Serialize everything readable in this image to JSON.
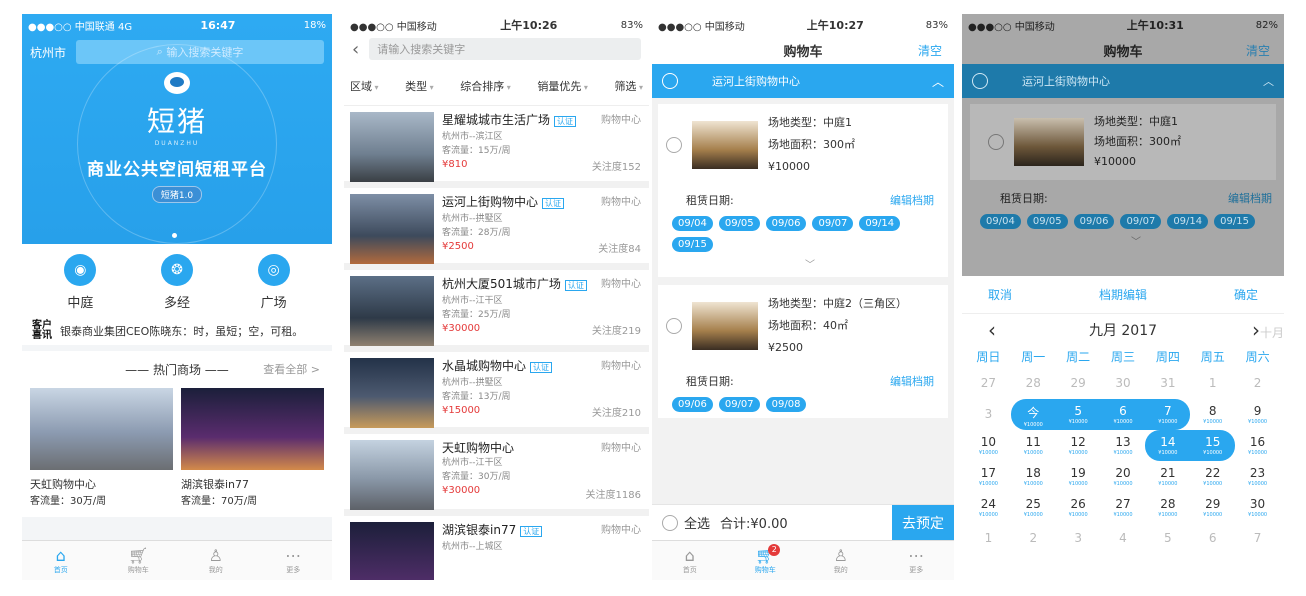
{
  "phone1": {
    "status": {
      "carrier": "●●●○○ 中国联通 4G",
      "time": "16:47",
      "battery": "18%"
    },
    "city": "杭州市",
    "search_placeholder": "输入搜索关键字",
    "brand": "短猪",
    "brand_sub": "DUANZHU",
    "slogan": "商业公共空间短租平台",
    "version": "短猪1.0",
    "categories": [
      "中庭",
      "多经",
      "广场"
    ],
    "news_tag": "客户 喜讯",
    "news": "银泰商业集团CEO陈晓东：时，虽短；空，可租。",
    "hot_title": "—— 热门商场 ——",
    "hot_all": "查看全部 >",
    "malls": [
      {
        "name": "天虹购物中心",
        "flow": "客流量：30万/周"
      },
      {
        "name": "湖滨银泰in77",
        "flow": "客流量：70万/周"
      }
    ],
    "tabs": [
      "首页",
      "购物车",
      "我的",
      "更多"
    ]
  },
  "phone2": {
    "status": {
      "carrier": "●●●○○ 中国移动",
      "time": "上午10:26",
      "battery": "83%"
    },
    "search_placeholder": "请输入搜索关键字",
    "filters": [
      "区域",
      "类型",
      "综合排序",
      "销量优先",
      "筛选"
    ],
    "items": [
      {
        "title": "星耀城城市生活广场",
        "cert": "认证",
        "type": "购物中心",
        "district": "杭州市--滨江区",
        "flow": "客流量：15万/周",
        "price": "¥810",
        "follow": "关注度152"
      },
      {
        "title": "运河上街购物中心",
        "cert": "认证",
        "type": "购物中心",
        "district": "杭州市--拱墅区",
        "flow": "客流量：28万/周",
        "price": "¥2500",
        "follow": "关注度84"
      },
      {
        "title": "杭州大厦501城市广场",
        "cert": "认证",
        "type": "购物中心",
        "district": "杭州市--江干区",
        "flow": "客流量：25万/周",
        "price": "¥30000",
        "follow": "关注度219"
      },
      {
        "title": "水晶城购物中心",
        "cert": "认证",
        "type": "购物中心",
        "district": "杭州市--拱墅区",
        "flow": "客流量：13万/周",
        "price": "¥15000",
        "follow": "关注度210"
      },
      {
        "title": "天虹购物中心",
        "cert": "",
        "type": "购物中心",
        "district": "杭州市--江干区",
        "flow": "客流量：30万/周",
        "price": "¥30000",
        "follow": "关注度1186"
      },
      {
        "title": "湖滨银泰in77",
        "cert": "认证",
        "type": "购物中心",
        "district": "杭州市--上城区",
        "flow": "",
        "price": "",
        "follow": ""
      }
    ]
  },
  "phone3": {
    "status": {
      "carrier": "●●●○○ 中国移动",
      "time": "上午10:27",
      "battery": "83%"
    },
    "title": "购物车",
    "clear": "清空",
    "group": "运河上街购物中心",
    "venues": [
      {
        "type": "场地类型：中庭1",
        "area": "场地面积：300㎡",
        "price": "¥10000",
        "rent_label": "租赁日期:",
        "edit": "编辑档期",
        "dates": [
          "09/04",
          "09/05",
          "09/06",
          "09/07",
          "09/14",
          "09/15"
        ]
      },
      {
        "type": "场地类型：中庭2（三角区）",
        "area": "场地面积：40㎡",
        "price": "¥2500",
        "rent_label": "租赁日期:",
        "edit": "编辑档期",
        "dates": [
          "09/06",
          "09/07",
          "09/08"
        ]
      }
    ],
    "select_all": "全选",
    "total": "合计:¥0.00",
    "book": "去预定",
    "badge": "2",
    "tabs": [
      "首页",
      "购物车",
      "我的",
      "更多"
    ]
  },
  "phone4": {
    "status": {
      "carrier": "●●●○○ 中国移动",
      "time": "上午10:31",
      "battery": "82%"
    },
    "title": "购物车",
    "clear": "清空",
    "group": "运河上街购物中心",
    "venue": {
      "type": "场地类型：中庭1",
      "area": "场地面积：300㎡",
      "price": "¥10000",
      "rent_label": "租赁日期:",
      "edit": "编辑档期",
      "dates": [
        "09/04",
        "09/05",
        "09/06",
        "09/07",
        "09/14",
        "09/15"
      ]
    },
    "cancel": "取消",
    "edit_title": "档期编辑",
    "confirm": "确定",
    "month": "九月 2017",
    "next_month": "十月",
    "weekdays": [
      "周日",
      "周一",
      "周二",
      "周三",
      "周四",
      "周五",
      "周六"
    ],
    "today": "今",
    "day_price": "¥10000",
    "rows": [
      [
        "27",
        "28",
        "29",
        "30",
        "31",
        "1",
        "2"
      ],
      [
        "3",
        "今",
        "5",
        "6",
        "7",
        "8",
        "9"
      ],
      [
        "10",
        "11",
        "12",
        "13",
        "14",
        "15",
        "16"
      ],
      [
        "17",
        "18",
        "19",
        "20",
        "21",
        "22",
        "23"
      ],
      [
        "24",
        "25",
        "26",
        "27",
        "28",
        "29",
        "30"
      ],
      [
        "1",
        "2",
        "3",
        "4",
        "5",
        "6",
        "7"
      ]
    ]
  }
}
